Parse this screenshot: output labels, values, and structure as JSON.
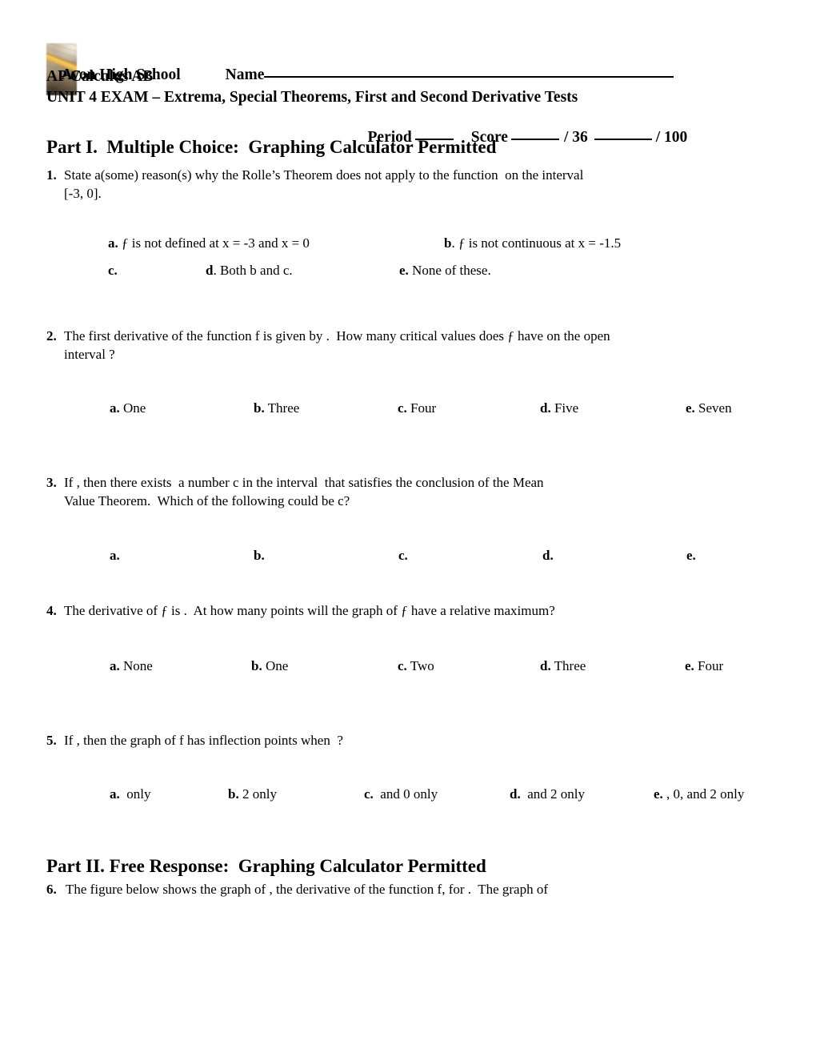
{
  "document": {
    "school": "Avon High School",
    "course": "AP Calculus AB",
    "exam_title": "UNIT 4 EXAM – Extrema, Special Theorems, First and Second Derivative Tests",
    "name_label": "Name",
    "period_label": "Period",
    "score_label": "Score",
    "score_out_of_1": "/ 36",
    "score_out_of_2": "/ 100",
    "header_image_name": "pencil-on-desk-photo"
  },
  "part1": {
    "heading": "Part I.  Multiple Choice:  Graphing Calculator Permitted",
    "questions": [
      {
        "number": "1.",
        "text": "State a(some) reason(s) why the Rolle’s Theorem does not apply to the function  on the interval [-3, 0].",
        "options_row1": [
          {
            "letter": "a.",
            "text": "ƒ is not defined at x = -3 and x = 0"
          },
          {
            "letter": "b",
            "text": ". ƒ is not continuous at x = -1.5"
          }
        ],
        "options_row2": [
          {
            "letter": "c.",
            "text": ""
          },
          {
            "letter": "d",
            "text": ". Both b and c."
          },
          {
            "letter": "e.",
            "text": "None of these."
          }
        ]
      },
      {
        "number": "2.",
        "text": "The first derivative of the function f is given by .  How many critical values does ƒ have on the open interval ?",
        "options": [
          {
            "letter": "a.",
            "text": "One"
          },
          {
            "letter": "b.",
            "text": "Three"
          },
          {
            "letter": "c.",
            "text": "Four"
          },
          {
            "letter": "d.",
            "text": "Five"
          },
          {
            "letter": "e.",
            "text": "Seven"
          }
        ]
      },
      {
        "number": "3.",
        "text": "If , then there exists  a number c in the interval  that satisfies the conclusion of the Mean Value Theorem.  Which of the following could be c?",
        "options": [
          {
            "letter": "a.",
            "text": ""
          },
          {
            "letter": "b.",
            "text": ""
          },
          {
            "letter": "c.",
            "text": ""
          },
          {
            "letter": "d.",
            "text": ""
          },
          {
            "letter": "e.",
            "text": ""
          }
        ]
      },
      {
        "number": "4.",
        "text": "The derivative of ƒ is .  At how many points will the graph of ƒ have a relative maximum?",
        "options": [
          {
            "letter": "a.",
            "text": "None"
          },
          {
            "letter": "b.",
            "text": "One"
          },
          {
            "letter": "c.",
            "text": "Two"
          },
          {
            "letter": "d.",
            "text": "Three"
          },
          {
            "letter": "e.",
            "text": "Four"
          }
        ]
      },
      {
        "number": "5.",
        "text": "If , then the graph of f has inflection points when  ?",
        "options": [
          {
            "letter": "a.",
            "text": " only"
          },
          {
            "letter": "b.",
            "text": "2 only"
          },
          {
            "letter": "c.",
            "text": " and 0 only"
          },
          {
            "letter": "d.",
            "text": " and 2 only"
          },
          {
            "letter": "e.",
            "text": ", 0, and 2 only"
          }
        ]
      }
    ]
  },
  "part2": {
    "heading": "Part II. Free Response:  Graphing Calculator Permitted",
    "questions": [
      {
        "number": "6.",
        "text": "The figure below shows the graph of , the derivative of the function f, for .  The graph of"
      }
    ]
  }
}
